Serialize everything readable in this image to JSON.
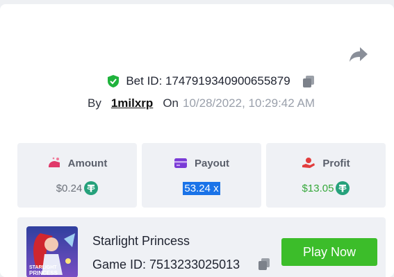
{
  "bet": {
    "label": "Bet ID: 1747919340900655879",
    "by_label": "By",
    "username": "1milxrp",
    "on_label": "On",
    "datetime": "10/28/2022, 10:29:42 AM"
  },
  "stats": {
    "amount": {
      "label": "Amount",
      "value": "$0.24"
    },
    "payout": {
      "label": "Payout",
      "value": "53.24 x"
    },
    "profit": {
      "label": "Profit",
      "value": "$13.05"
    }
  },
  "game": {
    "name": "Starlight Princess",
    "id_label": "Game ID: 7513233025013",
    "play_label": "Play Now",
    "thumb_text_1": "STARLIGHT",
    "thumb_text_2": "PRINCESS"
  },
  "colors": {
    "accent_green": "#3cbd2a",
    "verified_green": "#1fb33c",
    "tether_green": "#26a17b",
    "amount_pink": "#e0396a",
    "payout_purple": "#7a3bd6",
    "profit_red": "#e23d3d",
    "selection_blue": "#1a73e8"
  },
  "icons": [
    "share-icon",
    "verified-shield-icon",
    "copy-icon",
    "amount-icon",
    "payout-icon",
    "profit-icon",
    "tether-coin-icon"
  ]
}
